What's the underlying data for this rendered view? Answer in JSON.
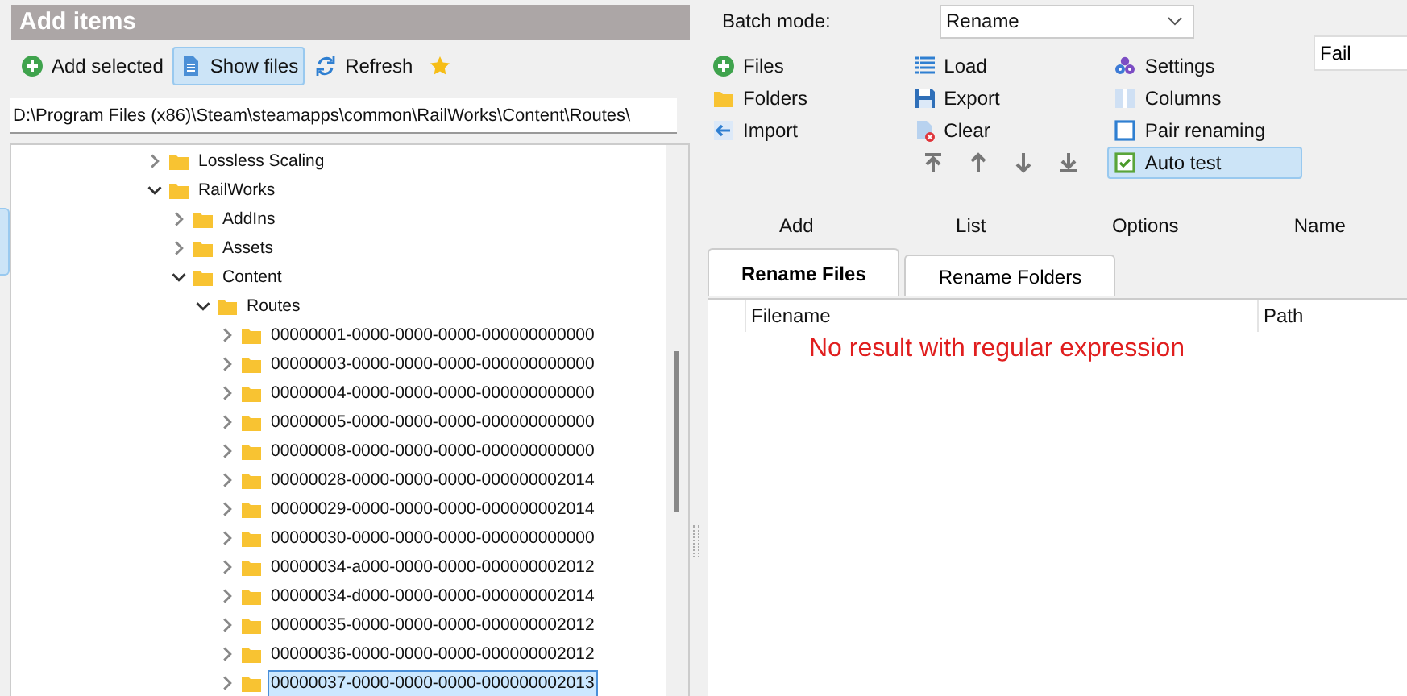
{
  "add_panel": {
    "title": "Add items",
    "toolbar": [
      {
        "label": "Add selected",
        "kind": "add",
        "on": false
      },
      {
        "label": "Show files",
        "kind": "file",
        "on": true
      },
      {
        "label": "Refresh",
        "kind": "refresh",
        "on": false
      },
      {
        "kind": "star",
        "on": false
      }
    ],
    "path_field": {
      "value": "D:\\Program Files (x86)\\Steam\\steamapps\\common\\RailWorks\\Content\\Routes\\"
    },
    "tree": [
      {
        "label": "Lossless Scaling",
        "expanded": false,
        "selected": false
      },
      {
        "label": "RailWorks",
        "expanded": true,
        "selected": false,
        "children": [
          {
            "label": "AddIns",
            "expanded": false,
            "selected": false
          },
          {
            "label": "Assets",
            "expanded": false,
            "selected": false
          },
          {
            "label": "Content",
            "expanded": true,
            "selected": false,
            "children": [
              {
                "label": "Routes",
                "expanded": true,
                "selected": false,
                "children": [
                  {
                    "label": "00000001-0000-0000-0000-000000000000",
                    "expanded": false,
                    "selected": false
                  },
                  {
                    "label": "00000003-0000-0000-0000-000000000000",
                    "expanded": false,
                    "selected": false
                  },
                  {
                    "label": "00000004-0000-0000-0000-000000000000",
                    "expanded": false,
                    "selected": false
                  },
                  {
                    "label": "00000005-0000-0000-0000-000000000000",
                    "expanded": false,
                    "selected": false
                  },
                  {
                    "label": "00000008-0000-0000-0000-000000000000",
                    "expanded": false,
                    "selected": false
                  },
                  {
                    "label": "00000028-0000-0000-0000-000000002014",
                    "expanded": false,
                    "selected": false
                  },
                  {
                    "label": "00000029-0000-0000-0000-000000002014",
                    "expanded": false,
                    "selected": false
                  },
                  {
                    "label": "00000030-0000-0000-0000-000000000000",
                    "expanded": false,
                    "selected": false
                  },
                  {
                    "label": "00000034-a000-0000-0000-000000002012",
                    "expanded": false,
                    "selected": false
                  },
                  {
                    "label": "00000034-d000-0000-0000-000000002014",
                    "expanded": false,
                    "selected": false
                  },
                  {
                    "label": "00000035-0000-0000-0000-000000002012",
                    "expanded": false,
                    "selected": false
                  },
                  {
                    "label": "00000036-0000-0000-0000-000000002012",
                    "expanded": false,
                    "selected": false
                  },
                  {
                    "label": "00000037-0000-0000-0000-000000002013",
                    "expanded": false,
                    "selected": true
                  }
                ]
              }
            ]
          }
        ]
      }
    ]
  },
  "batch_mode": {
    "label": "Batch mode:",
    "value": "Rename"
  },
  "actions": [
    [
      {
        "label": "Files",
        "kind": "add"
      },
      {
        "label": "Folders",
        "kind": "folder"
      },
      {
        "label": "Import",
        "kind": "import"
      }
    ],
    [
      {
        "label": "Load",
        "kind": "list"
      },
      {
        "label": "Export",
        "kind": "save"
      },
      {
        "label": "Clear",
        "kind": "clear"
      }
    ],
    [
      {
        "label": "Settings",
        "kind": "gears"
      },
      {
        "label": "Columns",
        "kind": "columns"
      },
      {
        "label": "Pair renaming",
        "kind": "checkbox",
        "checked": false,
        "highlighted": false
      },
      {
        "label": "Auto test",
        "kind": "checkbox",
        "checked": true,
        "highlighted": true
      }
    ]
  ],
  "filter_field": {
    "value": "Fail"
  },
  "group_labels": [
    "Add",
    "List",
    "Options",
    "Name"
  ],
  "tabs": [
    {
      "label": "Rename Files",
      "selected": true
    },
    {
      "label": "Rename Folders",
      "selected": false
    }
  ],
  "table": {
    "columns": [
      "Filename",
      "Path"
    ],
    "message": "No result with regular expression"
  }
}
